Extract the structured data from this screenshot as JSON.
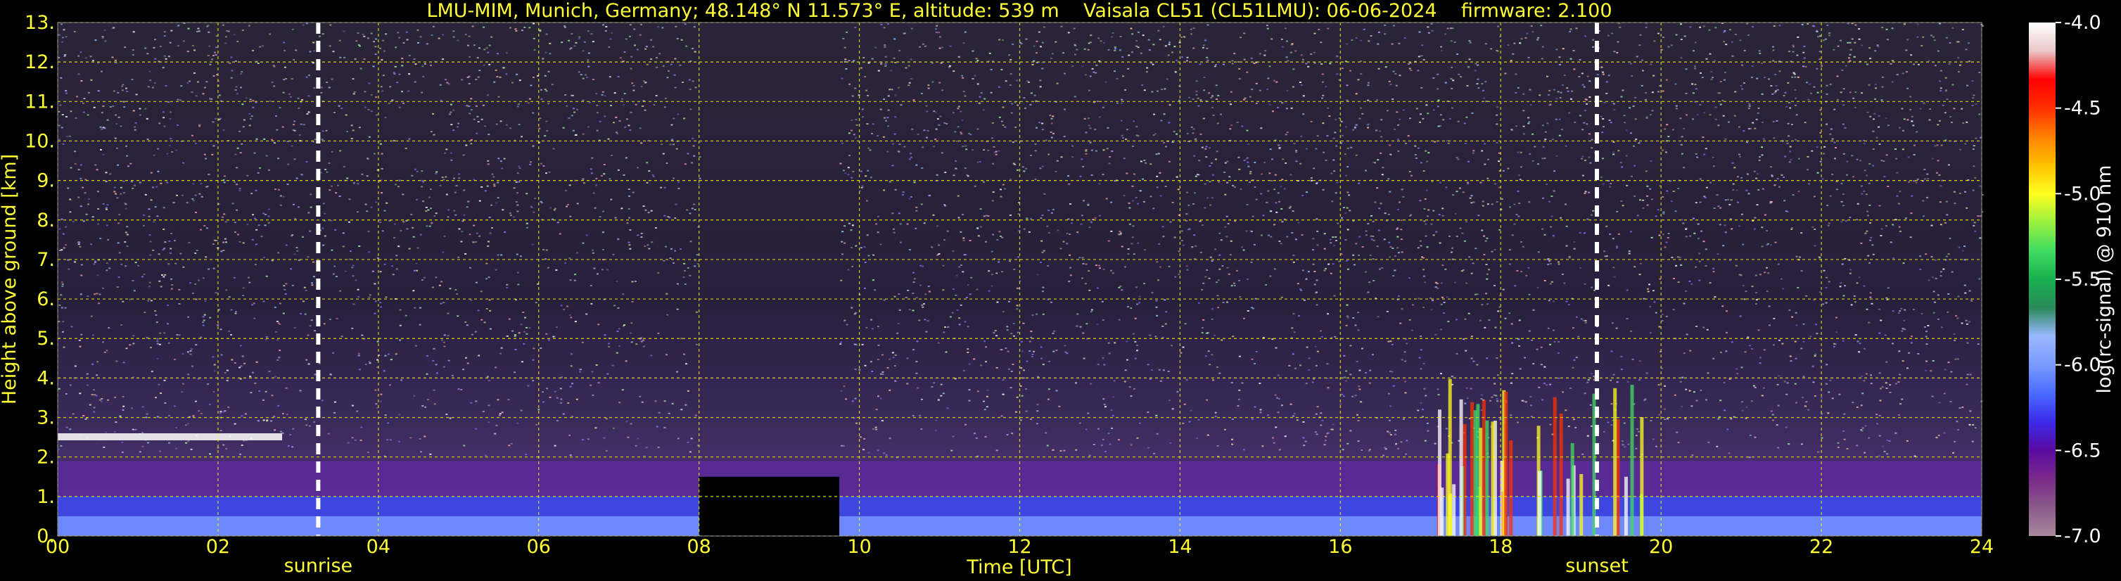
{
  "chart_data": {
    "type": "heatmap",
    "title": "LMU-MIM, Munich, Germany; 48.148° N 11.573° E, altitude: 539 m    Vaisala CL51 (CL51LMU): 06-06-2024    firmware: 2.100",
    "xlabel": "Time [UTC]",
    "ylabel": "Height above ground [km]",
    "xlim": [
      0,
      24
    ],
    "ylim": [
      0,
      13
    ],
    "x_ticks": [
      "00",
      "02",
      "04",
      "06",
      "08",
      "10",
      "12",
      "14",
      "16",
      "18",
      "20",
      "22",
      "24"
    ],
    "y_ticks": [
      "0.",
      "1.",
      "2.",
      "3.",
      "4.",
      "5.",
      "6.",
      "7.",
      "8.",
      "9.",
      "10.",
      "11.",
      "12.",
      "13."
    ],
    "grid": true,
    "grid_color": "#ffff00",
    "colorbar": {
      "label": "log(rc-signal) @ 910 nm",
      "range": [
        -7.0,
        -4.0
      ],
      "ticks": [
        "-4.0",
        "-4.5",
        "-5.0",
        "-5.5",
        "-6.0",
        "-6.5",
        "-7.0"
      ],
      "colors": [
        "#a8889c",
        "#8a5a8a",
        "#7a2a8a",
        "#5a0aa0",
        "#3a2ae8",
        "#4a6aff",
        "#7a9aff",
        "#9ab8ff",
        "#2a8a5a",
        "#18b050",
        "#40dc60",
        "#9af040",
        "#ffff20",
        "#ffc000",
        "#ff8000",
        "#ff3000",
        "#ff0000",
        "#e8c8c8",
        "#ffffff"
      ]
    },
    "events": [
      {
        "label": "sunrise",
        "time": 3.25
      },
      {
        "label": "sunset",
        "time": 19.2
      }
    ],
    "missing_data": [
      [
        8.0,
        9.75
      ]
    ],
    "layers": [
      {
        "name": "boundary-layer",
        "t_start": 0,
        "t_end": 24,
        "top_km": 1.9
      },
      {
        "name": "residual-layer",
        "t_start": 0,
        "t_end": 2.8,
        "top_km": 2.6
      },
      {
        "name": "precipitation",
        "t_start": 17.2,
        "t_end": 19.8,
        "top_km": 4.0
      }
    ]
  }
}
